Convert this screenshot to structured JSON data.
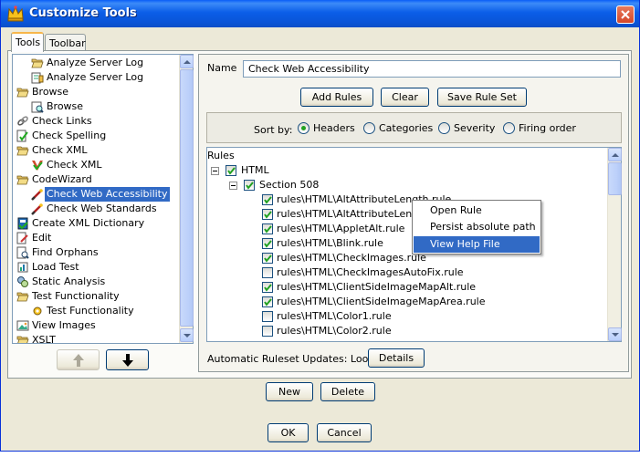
{
  "window": {
    "title": "Customize Tools"
  },
  "tabs": [
    {
      "label": "Tools"
    },
    {
      "label": "Toolbar"
    }
  ],
  "tree": {
    "items": [
      {
        "label": "Analyze Server Log",
        "icon": "folder-open-icon"
      },
      {
        "label": "Analyze Server Log",
        "icon": "log-tool-icon"
      },
      {
        "label": "Browse",
        "icon": "folder-open-icon"
      },
      {
        "label": "Browse",
        "icon": "browse-tool-icon"
      },
      {
        "label": "Check Links",
        "icon": "chain-link-icon"
      },
      {
        "label": "Check Spelling",
        "icon": "spellcheck-icon"
      },
      {
        "label": "Check XML",
        "icon": "folder-open-icon"
      },
      {
        "label": "Check XML",
        "icon": "xml-check-icon"
      },
      {
        "label": "CodeWizard",
        "icon": "folder-open-icon"
      },
      {
        "label": "Check Web Accessibility",
        "icon": "wizard-tool-icon"
      },
      {
        "label": "Check Web Standards",
        "icon": "wizard-tool-icon"
      },
      {
        "label": "Create XML Dictionary",
        "icon": "dictionary-icon"
      },
      {
        "label": "Edit",
        "icon": "edit-doc-icon"
      },
      {
        "label": "Find Orphans",
        "icon": "orphans-icon"
      },
      {
        "label": "Load Test",
        "icon": "load-test-icon"
      },
      {
        "label": "Static Analysis",
        "icon": "static-analysis-icon"
      },
      {
        "label": "Test Functionality",
        "icon": "folder-open-icon"
      },
      {
        "label": "Test Functionality",
        "icon": "functional-test-icon"
      },
      {
        "label": "View Images",
        "icon": "images-icon"
      },
      {
        "label": "XSLT",
        "icon": "folder-open-icon"
      }
    ],
    "selected": "Check Web Accessibility"
  },
  "name_field": {
    "label": "Name",
    "value": "Check Web Accessibility"
  },
  "buttons": {
    "add_rules": "Add Rules",
    "clear": "Clear",
    "save_rule_set": "Save Rule Set",
    "details": "Details",
    "new": "New",
    "delete": "Delete",
    "ok": "OK",
    "cancel": "Cancel"
  },
  "sort": {
    "label": "Sort by:",
    "options": [
      "Headers",
      "Categories",
      "Severity",
      "Firing order"
    ],
    "selected": "Headers"
  },
  "rules": {
    "header": "Rules",
    "root": "HTML",
    "section": "Section 508",
    "items": [
      {
        "label": "rules\\HTML\\AltAttributeLength.rule",
        "checked": true
      },
      {
        "label": "rules\\HTML\\AltAttributeLengthW",
        "checked": true
      },
      {
        "label": "rules\\HTML\\AppletAlt.rule",
        "checked": true
      },
      {
        "label": "rules\\HTML\\Blink.rule",
        "checked": true
      },
      {
        "label": "rules\\HTML\\CheckImages.rule",
        "checked": true
      },
      {
        "label": "rules\\HTML\\CheckImagesAutoFix.rule",
        "checked": false
      },
      {
        "label": "rules\\HTML\\ClientSideImageMapAlt.rule",
        "checked": true
      },
      {
        "label": "rules\\HTML\\ClientSideImageMapArea.rule",
        "checked": true
      },
      {
        "label": "rules\\HTML\\Color1.rule",
        "checked": false
      },
      {
        "label": "rules\\HTML\\Color2.rule",
        "checked": false
      }
    ]
  },
  "context_menu": {
    "items": [
      "Open Rule",
      "Persist absolute path",
      "View Help File"
    ],
    "highlighted": "View Help File"
  },
  "auto_updates": {
    "label": "Automatic Ruleset Updates: Loose"
  },
  "colors": {
    "title_bar": "#0a5ef7",
    "selection": "#316ac5",
    "dialog_bg": "#ece9d8"
  }
}
